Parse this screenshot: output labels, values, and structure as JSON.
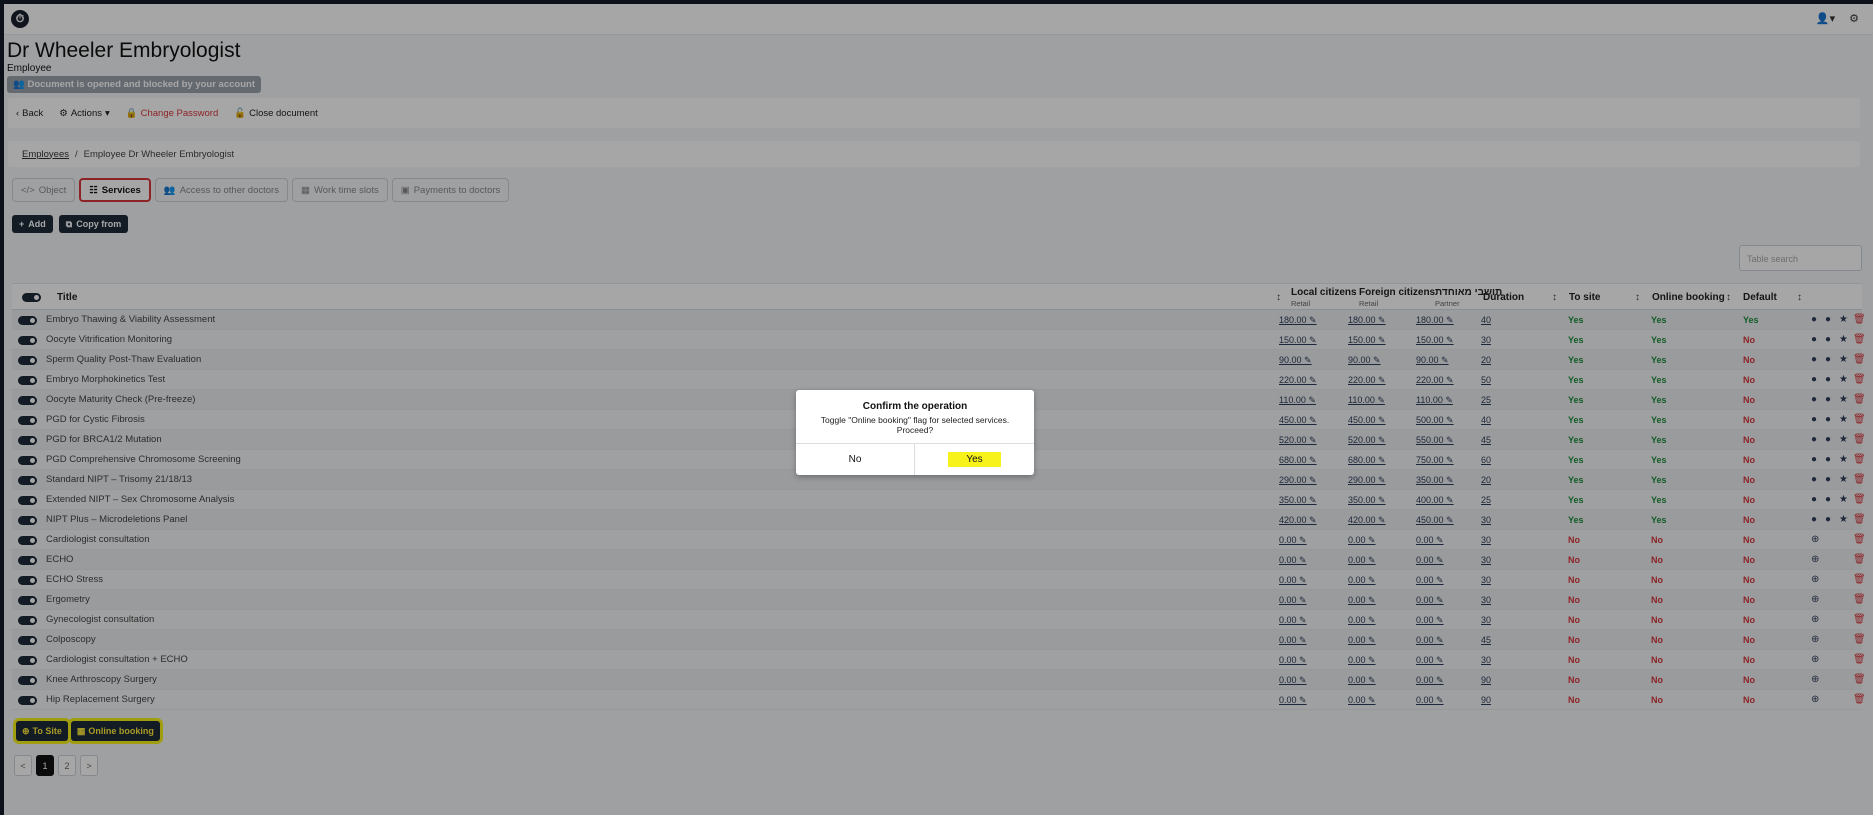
{
  "app": {
    "logo": "⏱",
    "user_icon": "user-icon",
    "settings_icon": "settings-icon"
  },
  "header": {
    "title": "Dr Wheeler Embryologist",
    "subtitle": "Employee",
    "lock_badge": "Document is opened and blocked by your account"
  },
  "actions": {
    "back": "Back",
    "actions": "Actions",
    "change_password": "Change Password",
    "close_document": "Close document"
  },
  "breadcrumb": {
    "root": "Employees",
    "sep": "/",
    "current": "Employee Dr Wheeler Embryologist"
  },
  "tabs": [
    {
      "label": "Object",
      "icon": "code-icon"
    },
    {
      "label": "Services",
      "icon": "services-icon",
      "active": true
    },
    {
      "label": "Access to other doctors",
      "icon": "users-icon"
    },
    {
      "label": "Work time slots",
      "icon": "calendar-icon"
    },
    {
      "label": "Payments to doctors",
      "icon": "money-icon"
    }
  ],
  "toolbar": {
    "add": "Add",
    "copy_from": "Copy from"
  },
  "search": {
    "placeholder": "Table search"
  },
  "table": {
    "columns": {
      "title": "Title",
      "local": "Local citizens",
      "local_sub": "Retail",
      "foreign": "Foreign citizens",
      "foreign_sub": "Retail",
      "partner": "תושבי מאוחדת",
      "partner_sub": "Partner",
      "duration": "Duration",
      "to_site": "To site",
      "online": "Online booking",
      "default": "Default"
    },
    "rows": [
      {
        "title": "Embryo Thawing & Viability Assessment",
        "local": "180.00",
        "foreign": "180.00",
        "partner": "180.00",
        "duration": "40",
        "to_site": "Yes",
        "online": "Yes",
        "default": "Yes"
      },
      {
        "title": "Oocyte Vitrification Monitoring",
        "local": "150.00",
        "foreign": "150.00",
        "partner": "150.00",
        "duration": "30",
        "to_site": "Yes",
        "online": "Yes",
        "default": "No"
      },
      {
        "title": "Sperm Quality Post-Thaw Evaluation",
        "local": "90.00",
        "foreign": "90.00",
        "partner": "90.00",
        "duration": "20",
        "to_site": "Yes",
        "online": "Yes",
        "default": "No"
      },
      {
        "title": "Embryo Morphokinetics Test",
        "local": "220.00",
        "foreign": "220.00",
        "partner": "220.00",
        "duration": "50",
        "to_site": "Yes",
        "online": "Yes",
        "default": "No"
      },
      {
        "title": "Oocyte Maturity Check (Pre-freeze)",
        "local": "110.00",
        "foreign": "110.00",
        "partner": "110.00",
        "duration": "25",
        "to_site": "Yes",
        "online": "Yes",
        "default": "No"
      },
      {
        "title": "PGD for Cystic Fibrosis",
        "local": "450.00",
        "foreign": "450.00",
        "partner": "500.00",
        "duration": "40",
        "to_site": "Yes",
        "online": "Yes",
        "default": "No"
      },
      {
        "title": "PGD for BRCA1/2 Mutation",
        "local": "520.00",
        "foreign": "520.00",
        "partner": "550.00",
        "duration": "45",
        "to_site": "Yes",
        "online": "Yes",
        "default": "No"
      },
      {
        "title": "PGD Comprehensive Chromosome Screening",
        "local": "680.00",
        "foreign": "680.00",
        "partner": "750.00",
        "duration": "60",
        "to_site": "Yes",
        "online": "Yes",
        "default": "No"
      },
      {
        "title": "Standard NIPT – Trisomy 21/18/13",
        "local": "290.00",
        "foreign": "290.00",
        "partner": "350.00",
        "duration": "20",
        "to_site": "Yes",
        "online": "Yes",
        "default": "No"
      },
      {
        "title": "Extended NIPT – Sex Chromosome Analysis",
        "local": "350.00",
        "foreign": "350.00",
        "partner": "400.00",
        "duration": "25",
        "to_site": "Yes",
        "online": "Yes",
        "default": "No"
      },
      {
        "title": "NIPT Plus – Microdeletions Panel",
        "local": "420.00",
        "foreign": "420.00",
        "partner": "450.00",
        "duration": "30",
        "to_site": "Yes",
        "online": "Yes",
        "default": "No"
      },
      {
        "title": "Cardiologist consultation",
        "local": "0.00",
        "foreign": "0.00",
        "partner": "0.00",
        "duration": "30",
        "to_site": "No",
        "online": "No",
        "default": "No"
      },
      {
        "title": "ECHO",
        "local": "0.00",
        "foreign": "0.00",
        "partner": "0.00",
        "duration": "30",
        "to_site": "No",
        "online": "No",
        "default": "No"
      },
      {
        "title": "ECHO Stress",
        "local": "0.00",
        "foreign": "0.00",
        "partner": "0.00",
        "duration": "30",
        "to_site": "No",
        "online": "No",
        "default": "No"
      },
      {
        "title": "Ergometry",
        "local": "0.00",
        "foreign": "0.00",
        "partner": "0.00",
        "duration": "30",
        "to_site": "No",
        "online": "No",
        "default": "No"
      },
      {
        "title": "Gynecologist consultation",
        "local": "0.00",
        "foreign": "0.00",
        "partner": "0.00",
        "duration": "30",
        "to_site": "No",
        "online": "No",
        "default": "No"
      },
      {
        "title": "Colposcopy",
        "local": "0.00",
        "foreign": "0.00",
        "partner": "0.00",
        "duration": "45",
        "to_site": "No",
        "online": "No",
        "default": "No"
      },
      {
        "title": "Cardiologist consultation + ECHO",
        "local": "0.00",
        "foreign": "0.00",
        "partner": "0.00",
        "duration": "30",
        "to_site": "No",
        "online": "No",
        "default": "No"
      },
      {
        "title": "Knee Arthroscopy Surgery",
        "local": "0.00",
        "foreign": "0.00",
        "partner": "0.00",
        "duration": "90",
        "to_site": "No",
        "online": "No",
        "default": "No"
      },
      {
        "title": "Hip Replacement Surgery",
        "local": "0.00",
        "foreign": "0.00",
        "partner": "0.00",
        "duration": "90",
        "to_site": "No",
        "online": "No",
        "default": "No"
      }
    ]
  },
  "bulk": {
    "to_site": "To Site",
    "online": "Online booking"
  },
  "pagination": {
    "prev": "<",
    "pages": [
      "1",
      "2"
    ],
    "next": ">"
  },
  "modal": {
    "title": "Confirm the operation",
    "text": "Toggle \"Online booking\" flag for selected services. Proceed?",
    "no": "No",
    "yes": "Yes"
  }
}
